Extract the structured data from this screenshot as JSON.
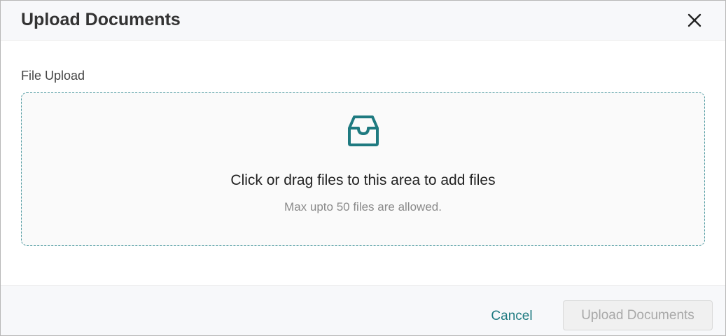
{
  "dialog": {
    "title": "Upload Documents",
    "close_icon": "close-icon"
  },
  "upload": {
    "label": "File Upload",
    "icon": "inbox-icon",
    "title": "Click or drag files to this area to add files",
    "hint": "Max upto 50 files are allowed."
  },
  "footer": {
    "cancel_label": "Cancel",
    "submit_label": "Upload Documents",
    "submit_disabled": true
  },
  "colors": {
    "accent": "#1e7a80",
    "dropzone_border": "#4f9aa0",
    "header_bg": "#f7f8fa"
  }
}
